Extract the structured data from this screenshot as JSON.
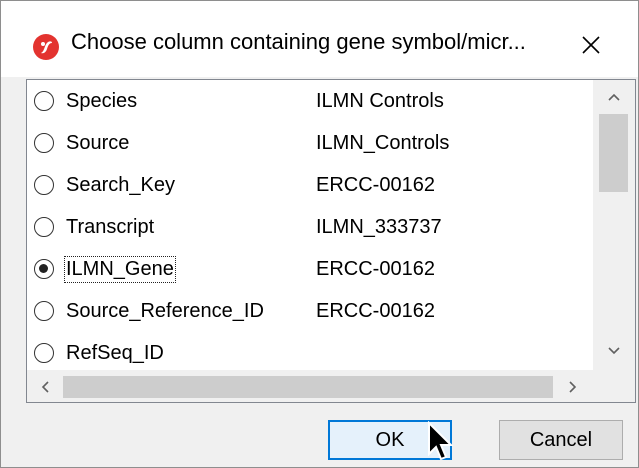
{
  "window": {
    "title": "Choose column containing gene symbol/micr...",
    "close_label": "✕"
  },
  "columns": [
    {
      "label": "Species",
      "value": "ILMN Controls",
      "selected": false
    },
    {
      "label": "Source",
      "value": "ILMN_Controls",
      "selected": false
    },
    {
      "label": "Search_Key",
      "value": "ERCC-00162",
      "selected": false
    },
    {
      "label": "Transcript",
      "value": "ILMN_333737",
      "selected": false
    },
    {
      "label": "ILMN_Gene",
      "value": "ERCC-00162",
      "selected": true
    },
    {
      "label": "Source_Reference_ID",
      "value": "ERCC-00162",
      "selected": false
    },
    {
      "label": "RefSeq_ID",
      "value": "",
      "selected": false
    }
  ],
  "buttons": {
    "ok": "OK",
    "cancel": "Cancel"
  },
  "colors": {
    "accent": "#0078d7",
    "app_icon": "#e3332f"
  }
}
